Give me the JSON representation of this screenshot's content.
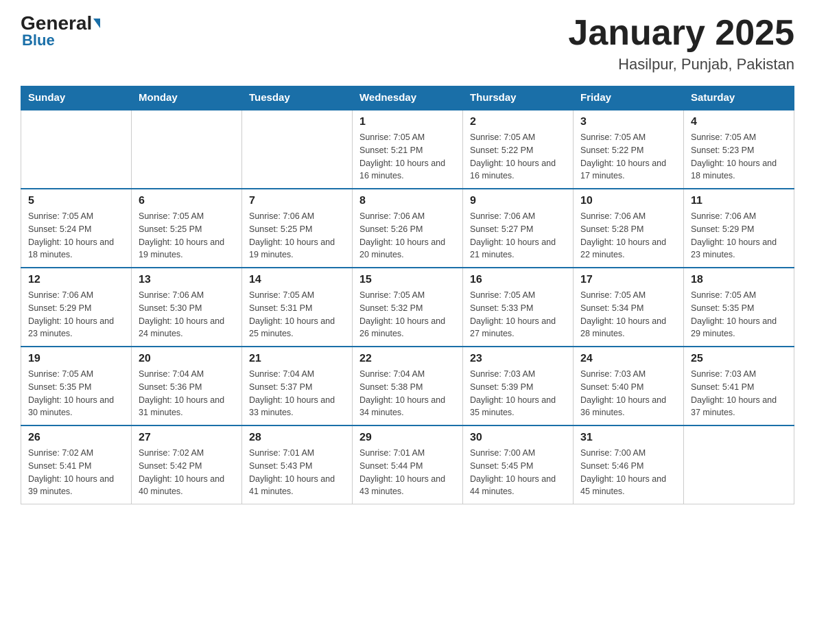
{
  "header": {
    "logo_general": "General",
    "logo_blue": "Blue",
    "month_year": "January 2025",
    "location": "Hasilpur, Punjab, Pakistan"
  },
  "days_of_week": [
    "Sunday",
    "Monday",
    "Tuesday",
    "Wednesday",
    "Thursday",
    "Friday",
    "Saturday"
  ],
  "weeks": [
    [
      {
        "day": "",
        "info": ""
      },
      {
        "day": "",
        "info": ""
      },
      {
        "day": "",
        "info": ""
      },
      {
        "day": "1",
        "info": "Sunrise: 7:05 AM\nSunset: 5:21 PM\nDaylight: 10 hours and 16 minutes."
      },
      {
        "day": "2",
        "info": "Sunrise: 7:05 AM\nSunset: 5:22 PM\nDaylight: 10 hours and 16 minutes."
      },
      {
        "day": "3",
        "info": "Sunrise: 7:05 AM\nSunset: 5:22 PM\nDaylight: 10 hours and 17 minutes."
      },
      {
        "day": "4",
        "info": "Sunrise: 7:05 AM\nSunset: 5:23 PM\nDaylight: 10 hours and 18 minutes."
      }
    ],
    [
      {
        "day": "5",
        "info": "Sunrise: 7:05 AM\nSunset: 5:24 PM\nDaylight: 10 hours and 18 minutes."
      },
      {
        "day": "6",
        "info": "Sunrise: 7:05 AM\nSunset: 5:25 PM\nDaylight: 10 hours and 19 minutes."
      },
      {
        "day": "7",
        "info": "Sunrise: 7:06 AM\nSunset: 5:25 PM\nDaylight: 10 hours and 19 minutes."
      },
      {
        "day": "8",
        "info": "Sunrise: 7:06 AM\nSunset: 5:26 PM\nDaylight: 10 hours and 20 minutes."
      },
      {
        "day": "9",
        "info": "Sunrise: 7:06 AM\nSunset: 5:27 PM\nDaylight: 10 hours and 21 minutes."
      },
      {
        "day": "10",
        "info": "Sunrise: 7:06 AM\nSunset: 5:28 PM\nDaylight: 10 hours and 22 minutes."
      },
      {
        "day": "11",
        "info": "Sunrise: 7:06 AM\nSunset: 5:29 PM\nDaylight: 10 hours and 23 minutes."
      }
    ],
    [
      {
        "day": "12",
        "info": "Sunrise: 7:06 AM\nSunset: 5:29 PM\nDaylight: 10 hours and 23 minutes."
      },
      {
        "day": "13",
        "info": "Sunrise: 7:06 AM\nSunset: 5:30 PM\nDaylight: 10 hours and 24 minutes."
      },
      {
        "day": "14",
        "info": "Sunrise: 7:05 AM\nSunset: 5:31 PM\nDaylight: 10 hours and 25 minutes."
      },
      {
        "day": "15",
        "info": "Sunrise: 7:05 AM\nSunset: 5:32 PM\nDaylight: 10 hours and 26 minutes."
      },
      {
        "day": "16",
        "info": "Sunrise: 7:05 AM\nSunset: 5:33 PM\nDaylight: 10 hours and 27 minutes."
      },
      {
        "day": "17",
        "info": "Sunrise: 7:05 AM\nSunset: 5:34 PM\nDaylight: 10 hours and 28 minutes."
      },
      {
        "day": "18",
        "info": "Sunrise: 7:05 AM\nSunset: 5:35 PM\nDaylight: 10 hours and 29 minutes."
      }
    ],
    [
      {
        "day": "19",
        "info": "Sunrise: 7:05 AM\nSunset: 5:35 PM\nDaylight: 10 hours and 30 minutes."
      },
      {
        "day": "20",
        "info": "Sunrise: 7:04 AM\nSunset: 5:36 PM\nDaylight: 10 hours and 31 minutes."
      },
      {
        "day": "21",
        "info": "Sunrise: 7:04 AM\nSunset: 5:37 PM\nDaylight: 10 hours and 33 minutes."
      },
      {
        "day": "22",
        "info": "Sunrise: 7:04 AM\nSunset: 5:38 PM\nDaylight: 10 hours and 34 minutes."
      },
      {
        "day": "23",
        "info": "Sunrise: 7:03 AM\nSunset: 5:39 PM\nDaylight: 10 hours and 35 minutes."
      },
      {
        "day": "24",
        "info": "Sunrise: 7:03 AM\nSunset: 5:40 PM\nDaylight: 10 hours and 36 minutes."
      },
      {
        "day": "25",
        "info": "Sunrise: 7:03 AM\nSunset: 5:41 PM\nDaylight: 10 hours and 37 minutes."
      }
    ],
    [
      {
        "day": "26",
        "info": "Sunrise: 7:02 AM\nSunset: 5:41 PM\nDaylight: 10 hours and 39 minutes."
      },
      {
        "day": "27",
        "info": "Sunrise: 7:02 AM\nSunset: 5:42 PM\nDaylight: 10 hours and 40 minutes."
      },
      {
        "day": "28",
        "info": "Sunrise: 7:01 AM\nSunset: 5:43 PM\nDaylight: 10 hours and 41 minutes."
      },
      {
        "day": "29",
        "info": "Sunrise: 7:01 AM\nSunset: 5:44 PM\nDaylight: 10 hours and 43 minutes."
      },
      {
        "day": "30",
        "info": "Sunrise: 7:00 AM\nSunset: 5:45 PM\nDaylight: 10 hours and 44 minutes."
      },
      {
        "day": "31",
        "info": "Sunrise: 7:00 AM\nSunset: 5:46 PM\nDaylight: 10 hours and 45 minutes."
      },
      {
        "day": "",
        "info": ""
      }
    ]
  ]
}
